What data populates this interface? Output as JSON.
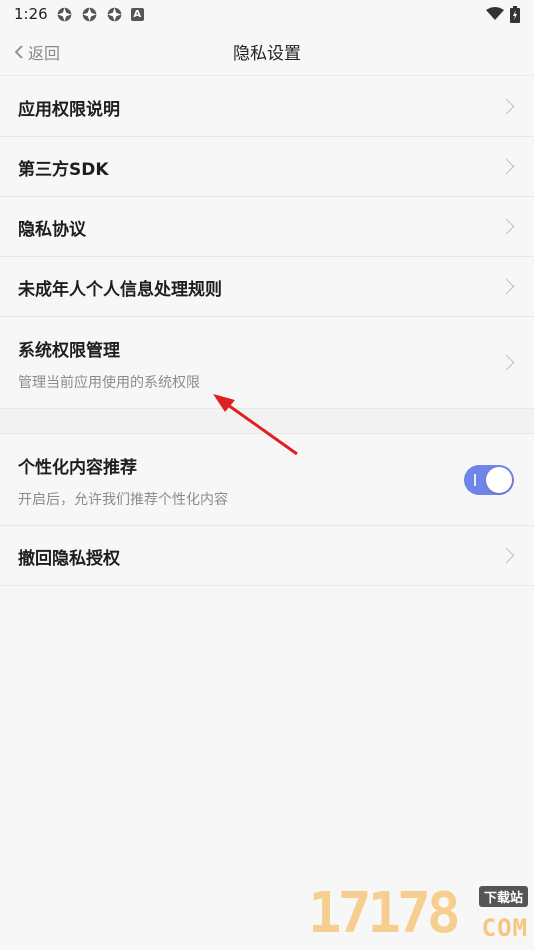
{
  "status_bar": {
    "time": "1:26",
    "icons": [
      "notification-icon",
      "notification-icon",
      "notification-icon",
      "a-app-icon"
    ],
    "a_icon_text": "A",
    "right_icons": [
      "wifi-icon",
      "battery-icon"
    ]
  },
  "nav": {
    "back_label": "返回",
    "title": "隐私设置"
  },
  "items": [
    {
      "title": "应用权限说明"
    },
    {
      "title": "第三方SDK"
    },
    {
      "title": "隐私协议"
    },
    {
      "title": "未成年人个人信息处理规则"
    },
    {
      "title": "系统权限管理",
      "subtitle": "管理当前应用使用的系统权限"
    }
  ],
  "personalize": {
    "title": "个性化内容推荐",
    "subtitle": "开启后，允许我们推荐个性化内容",
    "enabled": true
  },
  "revoke": {
    "title": "撤回隐私授权"
  },
  "annotation": {
    "arrow_color": "#e02020"
  },
  "watermark": {
    "number": "17178",
    "tag": "下载站",
    "domain": "COM"
  },
  "colors": {
    "toggle_on": "#6f86e8",
    "background": "#f7f7f7"
  }
}
